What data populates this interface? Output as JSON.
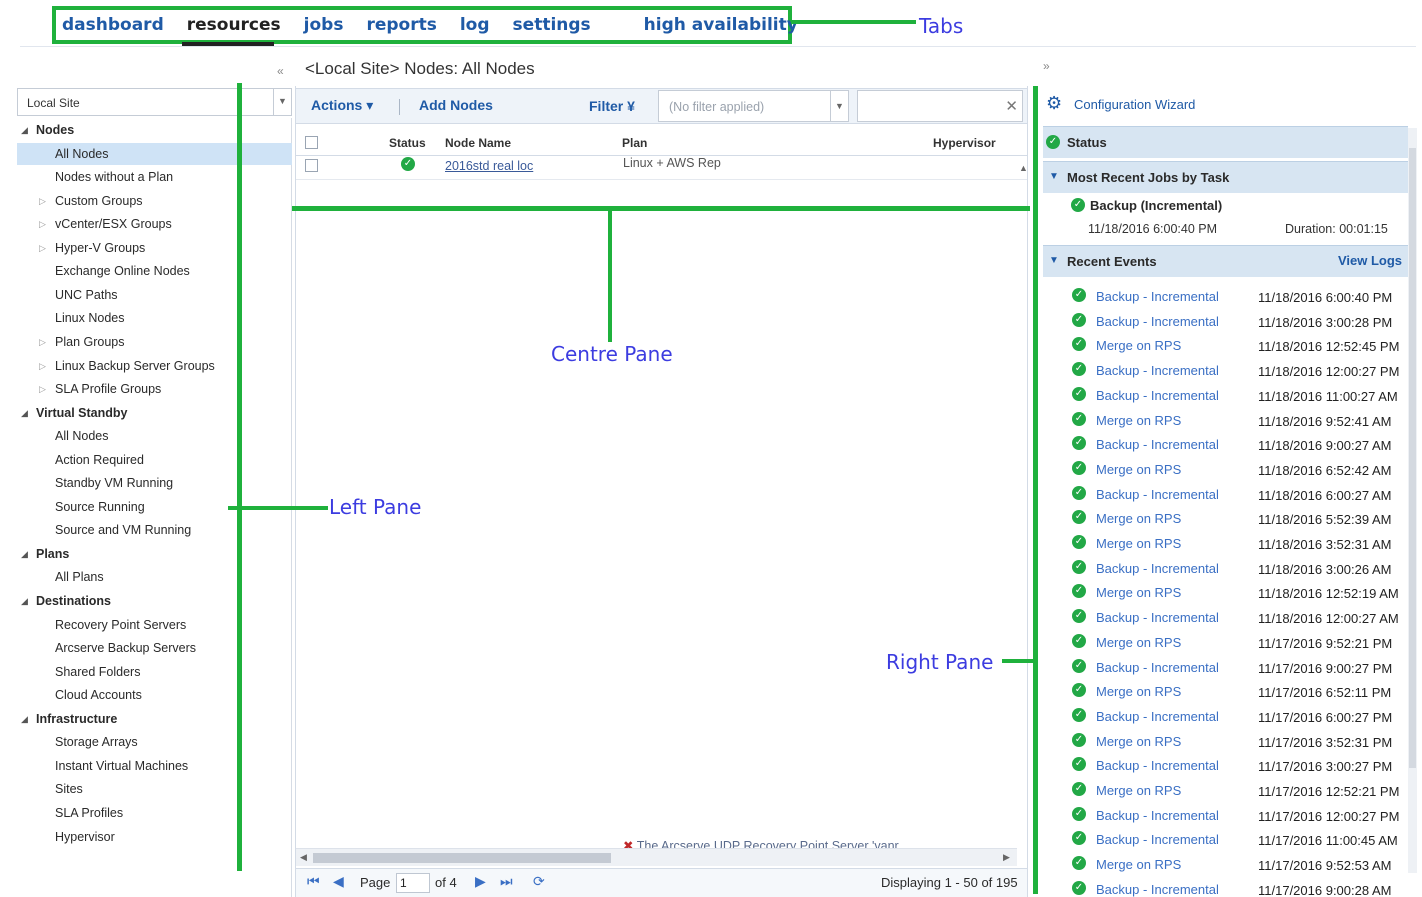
{
  "tabs": [
    {
      "label": "dashboard",
      "active": false
    },
    {
      "label": "resources",
      "active": true
    },
    {
      "label": "jobs",
      "active": false
    },
    {
      "label": "reports",
      "active": false
    },
    {
      "label": "log",
      "active": false
    },
    {
      "label": "settings",
      "active": false
    },
    {
      "label": "high availability",
      "active": false
    }
  ],
  "annotations": {
    "tabs": "Tabs",
    "left_pane": "Left Pane",
    "centre_pane": "Centre Pane",
    "right_pane": "Right Pane"
  },
  "left_pane": {
    "site_selected": "Local Site",
    "tree": [
      {
        "label": "Nodes",
        "kind": "category",
        "expanded": true
      },
      {
        "label": "All Nodes",
        "kind": "child",
        "selected": true
      },
      {
        "label": "Nodes without a Plan",
        "kind": "child"
      },
      {
        "label": "Custom Groups",
        "kind": "child",
        "expandable": true
      },
      {
        "label": "vCenter/ESX Groups",
        "kind": "child",
        "expandable": true
      },
      {
        "label": "Hyper-V Groups",
        "kind": "child",
        "expandable": true
      },
      {
        "label": "Exchange Online Nodes",
        "kind": "child"
      },
      {
        "label": "UNC Paths",
        "kind": "child"
      },
      {
        "label": "Linux Nodes",
        "kind": "child"
      },
      {
        "label": "Plan Groups",
        "kind": "child",
        "expandable": true
      },
      {
        "label": "Linux Backup Server Groups",
        "kind": "child",
        "expandable": true
      },
      {
        "label": "SLA Profile Groups",
        "kind": "child",
        "expandable": true
      },
      {
        "label": "Virtual Standby",
        "kind": "category",
        "expanded": true
      },
      {
        "label": "All Nodes",
        "kind": "child"
      },
      {
        "label": "Action Required",
        "kind": "child"
      },
      {
        "label": "Standby VM Running",
        "kind": "child"
      },
      {
        "label": "Source Running",
        "kind": "child"
      },
      {
        "label": "Source and VM Running",
        "kind": "child"
      },
      {
        "label": "Plans",
        "kind": "category",
        "expanded": true
      },
      {
        "label": "All Plans",
        "kind": "child"
      },
      {
        "label": "Destinations",
        "kind": "category",
        "expanded": true
      },
      {
        "label": "Recovery Point Servers",
        "kind": "child"
      },
      {
        "label": "Arcserve Backup Servers",
        "kind": "child"
      },
      {
        "label": "Shared Folders",
        "kind": "child"
      },
      {
        "label": "Cloud Accounts",
        "kind": "child"
      },
      {
        "label": "Infrastructure",
        "kind": "category",
        "expanded": true
      },
      {
        "label": "Storage Arrays",
        "kind": "child"
      },
      {
        "label": "Instant Virtual Machines",
        "kind": "child"
      },
      {
        "label": "Sites",
        "kind": "child"
      },
      {
        "label": "SLA Profiles",
        "kind": "child"
      },
      {
        "label": "Hypervisor",
        "kind": "child"
      }
    ]
  },
  "centre_pane": {
    "title": "<Local Site> Nodes: All Nodes",
    "toolbar": {
      "actions": "Actions",
      "add_nodes": "Add Nodes",
      "filter": "Filter",
      "filter_value": "(No filter applied)"
    },
    "columns": [
      "Status",
      "Node Name",
      "Plan",
      "Hypervisor"
    ],
    "rows": [
      {
        "status": "ok",
        "node_name": "2016std real loc",
        "plan": "Linux + AWS Rep",
        "hypervisor": ""
      }
    ],
    "partial_row_text": "The Arcserve UDP Recovery Point Server 'vanr",
    "pager": {
      "page_label": "Page",
      "page_value": "1",
      "of_label": "of 4",
      "displaying": "Displaying 1 - 50 of 195"
    }
  },
  "right_pane": {
    "config_wizard": "Configuration Wizard",
    "status_label": "Status",
    "recent_jobs_label": "Most Recent Jobs by Task",
    "recent_job": {
      "name": "Backup (Incremental)",
      "time": "11/18/2016 6:00:40 PM",
      "duration": "Duration: 00:01:15"
    },
    "recent_events_label": "Recent Events",
    "view_logs": "View Logs",
    "events": [
      {
        "name": "Backup - Incremental",
        "when": "11/18/2016 6:00:40 PM"
      },
      {
        "name": "Backup - Incremental",
        "when": "11/18/2016 3:00:28 PM"
      },
      {
        "name": "Merge on RPS",
        "when": "11/18/2016 12:52:45 PM"
      },
      {
        "name": "Backup - Incremental",
        "when": "11/18/2016 12:00:27 PM"
      },
      {
        "name": "Backup - Incremental",
        "when": "11/18/2016 11:00:27 AM"
      },
      {
        "name": "Merge on RPS",
        "when": "11/18/2016 9:52:41 AM"
      },
      {
        "name": "Backup - Incremental",
        "when": "11/18/2016 9:00:27 AM"
      },
      {
        "name": "Merge on RPS",
        "when": "11/18/2016 6:52:42 AM"
      },
      {
        "name": "Backup - Incremental",
        "when": "11/18/2016 6:00:27 AM"
      },
      {
        "name": "Merge on RPS",
        "when": "11/18/2016 5:52:39 AM"
      },
      {
        "name": "Merge on RPS",
        "when": "11/18/2016 3:52:31 AM"
      },
      {
        "name": "Backup - Incremental",
        "when": "11/18/2016 3:00:26 AM"
      },
      {
        "name": "Merge on RPS",
        "when": "11/18/2016 12:52:19 AM"
      },
      {
        "name": "Backup - Incremental",
        "when": "11/18/2016 12:00:27 AM"
      },
      {
        "name": "Merge on RPS",
        "when": "11/17/2016 9:52:21 PM"
      },
      {
        "name": "Backup - Incremental",
        "when": "11/17/2016 9:00:27 PM"
      },
      {
        "name": "Merge on RPS",
        "when": "11/17/2016 6:52:11 PM"
      },
      {
        "name": "Backup - Incremental",
        "when": "11/17/2016 6:00:27 PM"
      },
      {
        "name": "Merge on RPS",
        "when": "11/17/2016 3:52:31 PM"
      },
      {
        "name": "Backup - Incremental",
        "when": "11/17/2016 3:00:27 PM"
      },
      {
        "name": "Merge on RPS",
        "when": "11/17/2016 12:52:21 PM"
      },
      {
        "name": "Backup - Incremental",
        "when": "11/17/2016 12:00:27 PM"
      },
      {
        "name": "Backup - Incremental",
        "when": "11/17/2016 11:00:45 AM"
      },
      {
        "name": "Merge on RPS",
        "when": "11/17/2016 9:52:53 AM"
      },
      {
        "name": "Backup - Incremental",
        "when": "11/17/2016 9:00:28 AM"
      }
    ]
  },
  "colors": {
    "annotation_green": "#1fb13c",
    "annotation_text": "#3c3ce0",
    "link_blue": "#1f5aa6",
    "status_ok": "#22a846",
    "selection": "#cfe3f6",
    "section_header": "#d7e5f2"
  },
  "icons": {
    "status_ok": "check-circle-icon",
    "config": "gear-icon",
    "pager_first": "first-page-icon",
    "pager_prev": "prev-page-icon",
    "pager_next": "next-page-icon",
    "pager_last": "last-page-icon",
    "pager_refresh": "refresh-icon"
  }
}
